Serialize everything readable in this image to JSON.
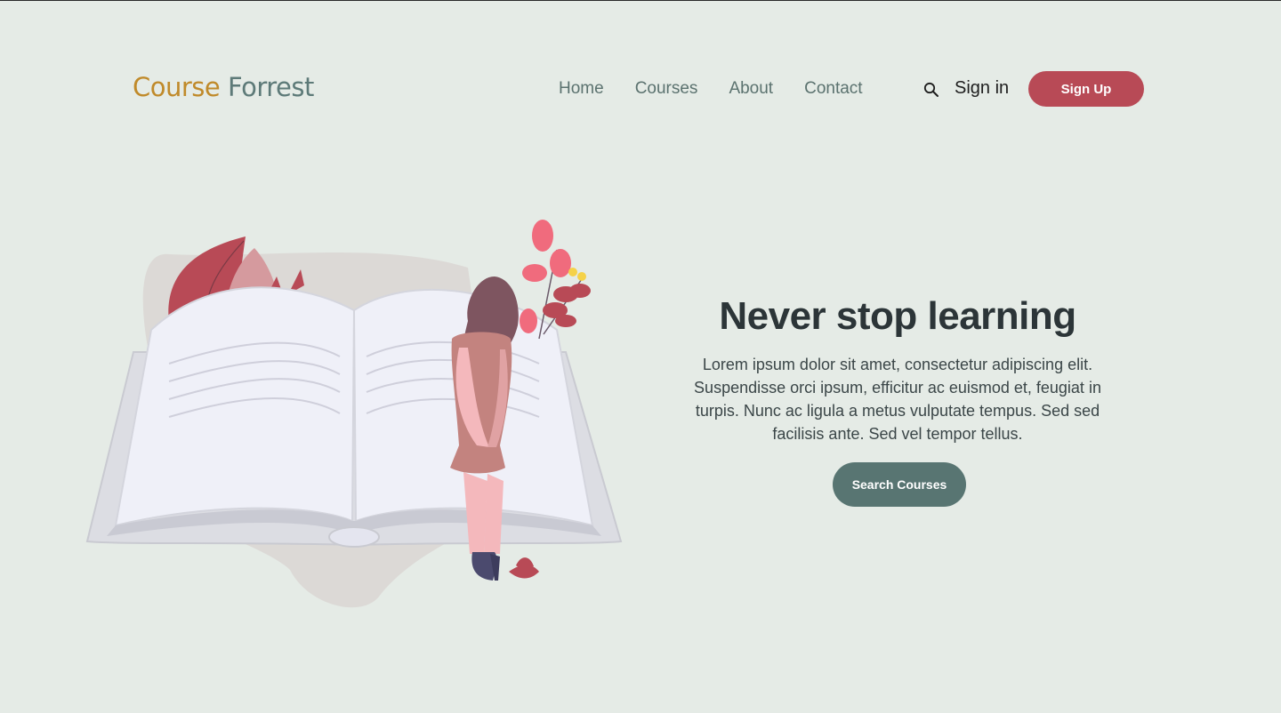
{
  "header": {
    "logo_word1": "Course",
    "logo_word2": "Forrest",
    "nav": [
      "Home",
      "Courses",
      "About",
      "Contact"
    ],
    "search_icon": "search-icon",
    "signin_label": "Sign in",
    "signup_label": "Sign Up"
  },
  "hero": {
    "title": "Never stop learning",
    "text": "Lorem ipsum dolor sit amet, consectetur adipiscing elit. Suspendisse orci ipsum, efficitur ac euismod et, feugiat in turpis. Nunc ac ligula a metus vulputate tempus. Sed sed facilisis ante. Sed vel tempor tellus.",
    "cta_label": "Search Courses"
  },
  "colors": {
    "background": "#e5ebe6",
    "logo_accent": "#c08a2a",
    "logo_secondary": "#5d7a78",
    "signup_button": "#b84a56",
    "cta_button": "#587572"
  }
}
